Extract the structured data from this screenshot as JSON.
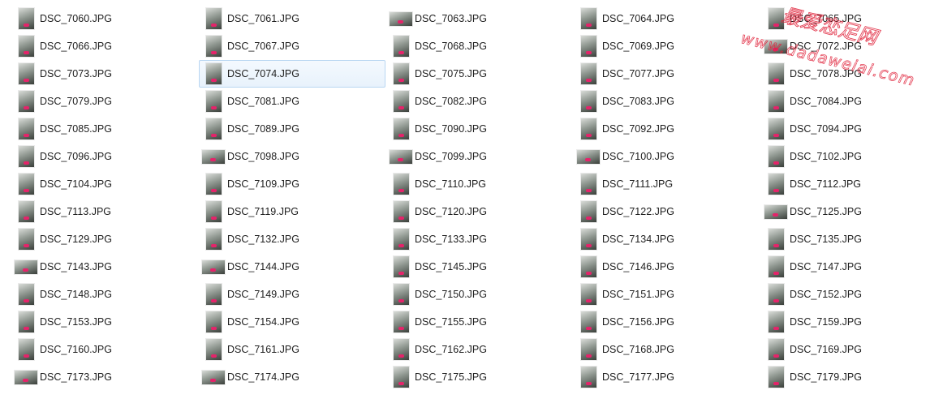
{
  "accent_color": "#e4246a",
  "files": [
    {
      "name": "DSC_7060.JPG",
      "icon": "photo-thumbnail",
      "orientation": "portrait"
    },
    {
      "name": "DSC_7066.JPG",
      "icon": "photo-thumbnail",
      "orientation": "portrait"
    },
    {
      "name": "DSC_7073.JPG",
      "icon": "photo-thumbnail",
      "orientation": "portrait"
    },
    {
      "name": "DSC_7079.JPG",
      "icon": "photo-thumbnail",
      "orientation": "portrait"
    },
    {
      "name": "DSC_7085.JPG",
      "icon": "photo-thumbnail",
      "orientation": "portrait"
    },
    {
      "name": "DSC_7096.JPG",
      "icon": "photo-thumbnail",
      "orientation": "portrait"
    },
    {
      "name": "DSC_7104.JPG",
      "icon": "photo-thumbnail",
      "orientation": "portrait"
    },
    {
      "name": "DSC_7113.JPG",
      "icon": "photo-thumbnail",
      "orientation": "portrait"
    },
    {
      "name": "DSC_7129.JPG",
      "icon": "photo-thumbnail",
      "orientation": "portrait"
    },
    {
      "name": "DSC_7143.JPG",
      "icon": "photo-thumbnail",
      "orientation": "landscape"
    },
    {
      "name": "DSC_7148.JPG",
      "icon": "photo-thumbnail",
      "orientation": "portrait"
    },
    {
      "name": "DSC_7153.JPG",
      "icon": "photo-thumbnail",
      "orientation": "portrait"
    },
    {
      "name": "DSC_7160.JPG",
      "icon": "photo-thumbnail",
      "orientation": "portrait"
    },
    {
      "name": "DSC_7173.JPG",
      "icon": "photo-thumbnail",
      "orientation": "landscape"
    },
    {
      "name": "DSC_7061.JPG",
      "icon": "photo-thumbnail",
      "orientation": "portrait"
    },
    {
      "name": "DSC_7067.JPG",
      "icon": "photo-thumbnail",
      "orientation": "portrait"
    },
    {
      "name": "DSC_7074.JPG",
      "icon": "photo-thumbnail",
      "orientation": "portrait",
      "selected": true
    },
    {
      "name": "DSC_7081.JPG",
      "icon": "photo-thumbnail",
      "orientation": "portrait"
    },
    {
      "name": "DSC_7089.JPG",
      "icon": "photo-thumbnail",
      "orientation": "portrait"
    },
    {
      "name": "DSC_7098.JPG",
      "icon": "photo-thumbnail",
      "orientation": "landscape"
    },
    {
      "name": "DSC_7109.JPG",
      "icon": "photo-thumbnail",
      "orientation": "portrait"
    },
    {
      "name": "DSC_7119.JPG",
      "icon": "photo-thumbnail",
      "orientation": "portrait"
    },
    {
      "name": "DSC_7132.JPG",
      "icon": "photo-thumbnail",
      "orientation": "portrait"
    },
    {
      "name": "DSC_7144.JPG",
      "icon": "photo-thumbnail",
      "orientation": "landscape"
    },
    {
      "name": "DSC_7149.JPG",
      "icon": "photo-thumbnail",
      "orientation": "portrait"
    },
    {
      "name": "DSC_7154.JPG",
      "icon": "photo-thumbnail",
      "orientation": "portrait"
    },
    {
      "name": "DSC_7161.JPG",
      "icon": "photo-thumbnail",
      "orientation": "portrait"
    },
    {
      "name": "DSC_7174.JPG",
      "icon": "photo-thumbnail",
      "orientation": "landscape"
    },
    {
      "name": "DSC_7063.JPG",
      "icon": "photo-thumbnail",
      "orientation": "landscape"
    },
    {
      "name": "DSC_7068.JPG",
      "icon": "photo-thumbnail",
      "orientation": "portrait"
    },
    {
      "name": "DSC_7075.JPG",
      "icon": "photo-thumbnail",
      "orientation": "portrait"
    },
    {
      "name": "DSC_7082.JPG",
      "icon": "photo-thumbnail",
      "orientation": "portrait"
    },
    {
      "name": "DSC_7090.JPG",
      "icon": "photo-thumbnail",
      "orientation": "portrait"
    },
    {
      "name": "DSC_7099.JPG",
      "icon": "photo-thumbnail",
      "orientation": "landscape"
    },
    {
      "name": "DSC_7110.JPG",
      "icon": "photo-thumbnail",
      "orientation": "portrait"
    },
    {
      "name": "DSC_7120.JPG",
      "icon": "photo-thumbnail",
      "orientation": "portrait"
    },
    {
      "name": "DSC_7133.JPG",
      "icon": "photo-thumbnail",
      "orientation": "portrait"
    },
    {
      "name": "DSC_7145.JPG",
      "icon": "photo-thumbnail",
      "orientation": "portrait"
    },
    {
      "name": "DSC_7150.JPG",
      "icon": "photo-thumbnail",
      "orientation": "portrait"
    },
    {
      "name": "DSC_7155.JPG",
      "icon": "photo-thumbnail",
      "orientation": "portrait"
    },
    {
      "name": "DSC_7162.JPG",
      "icon": "photo-thumbnail",
      "orientation": "portrait"
    },
    {
      "name": "DSC_7175.JPG",
      "icon": "photo-thumbnail",
      "orientation": "portrait"
    },
    {
      "name": "DSC_7064.JPG",
      "icon": "photo-thumbnail",
      "orientation": "portrait"
    },
    {
      "name": "DSC_7069.JPG",
      "icon": "photo-thumbnail",
      "orientation": "portrait"
    },
    {
      "name": "DSC_7077.JPG",
      "icon": "photo-thumbnail",
      "orientation": "portrait"
    },
    {
      "name": "DSC_7083.JPG",
      "icon": "photo-thumbnail",
      "orientation": "portrait"
    },
    {
      "name": "DSC_7092.JPG",
      "icon": "photo-thumbnail",
      "orientation": "portrait"
    },
    {
      "name": "DSC_7100.JPG",
      "icon": "photo-thumbnail",
      "orientation": "landscape"
    },
    {
      "name": "DSC_7111.JPG",
      "icon": "photo-thumbnail",
      "orientation": "portrait"
    },
    {
      "name": "DSC_7122.JPG",
      "icon": "photo-thumbnail",
      "orientation": "portrait"
    },
    {
      "name": "DSC_7134.JPG",
      "icon": "photo-thumbnail",
      "orientation": "portrait"
    },
    {
      "name": "DSC_7146.JPG",
      "icon": "photo-thumbnail",
      "orientation": "portrait"
    },
    {
      "name": "DSC_7151.JPG",
      "icon": "photo-thumbnail",
      "orientation": "portrait"
    },
    {
      "name": "DSC_7156.JPG",
      "icon": "photo-thumbnail",
      "orientation": "portrait"
    },
    {
      "name": "DSC_7168.JPG",
      "icon": "photo-thumbnail",
      "orientation": "portrait"
    },
    {
      "name": "DSC_7177.JPG",
      "icon": "photo-thumbnail",
      "orientation": "portrait"
    },
    {
      "name": "DSC_7065.JPG",
      "icon": "photo-thumbnail",
      "orientation": "portrait"
    },
    {
      "name": "DSC_7072.JPG",
      "icon": "photo-thumbnail",
      "orientation": "landscape"
    },
    {
      "name": "DSC_7078.JPG",
      "icon": "photo-thumbnail",
      "orientation": "portrait"
    },
    {
      "name": "DSC_7084.JPG",
      "icon": "photo-thumbnail",
      "orientation": "portrait"
    },
    {
      "name": "DSC_7094.JPG",
      "icon": "photo-thumbnail",
      "orientation": "portrait"
    },
    {
      "name": "DSC_7102.JPG",
      "icon": "photo-thumbnail",
      "orientation": "portrait"
    },
    {
      "name": "DSC_7112.JPG",
      "icon": "photo-thumbnail",
      "orientation": "portrait"
    },
    {
      "name": "DSC_7125.JPG",
      "icon": "photo-thumbnail",
      "orientation": "landscape"
    },
    {
      "name": "DSC_7135.JPG",
      "icon": "photo-thumbnail",
      "orientation": "portrait"
    },
    {
      "name": "DSC_7147.JPG",
      "icon": "photo-thumbnail",
      "orientation": "portrait"
    },
    {
      "name": "DSC_7152.JPG",
      "icon": "photo-thumbnail",
      "orientation": "portrait"
    },
    {
      "name": "DSC_7159.JPG",
      "icon": "photo-thumbnail",
      "orientation": "portrait"
    },
    {
      "name": "DSC_7169.JPG",
      "icon": "photo-thumbnail",
      "orientation": "portrait"
    },
    {
      "name": "DSC_7179.JPG",
      "icon": "photo-thumbnail",
      "orientation": "portrait"
    }
  ],
  "watermark": {
    "line1": "最爱恋足网",
    "line2": "www.dadaweiai.com",
    "color": "#e0243c"
  }
}
